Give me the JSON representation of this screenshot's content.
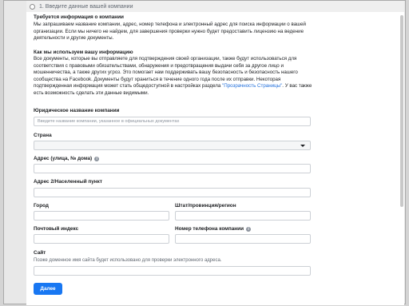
{
  "step": {
    "label": "1. Введите данные вашей компании"
  },
  "info_section": {
    "title": "Требуется информация о компании",
    "body": "Мы запрашиваем название компании, адрес, номер телефона и электронный адрес для поиска информации о вашей организации. Если мы ничего не найдем, для завершения проверки нужно будет предоставить лицензию на ведение деятельности и другие документы."
  },
  "usage_section": {
    "title": "Как мы используем вашу информацию",
    "body_start": "Все документы, которые вы отправляете для подтверждения своей организации, также будут использоваться для соответствия с правовыми обязательствами, обнаружения и предотвращения выдачи себя за другое лицо и мошенничества, а также других угроз. Это помогает нам поддерживать вашу безопасность и безопасность нашего сообщества на Facebook. Документы будут храниться в течение одного года после их отправки. Некоторая подтвержденная информация может стать общедоступной в настройках раздела ",
    "link": "\"Прозрачность Страницы\"",
    "body_end": ". У вас также есть возможность сделать эти данные видимыми."
  },
  "form": {
    "legal_name": {
      "label": "Юридическое название компании",
      "placeholder": "Введите название компании, указанное в официальных документах",
      "value": ""
    },
    "country": {
      "label": "Страна",
      "value": ""
    },
    "address1": {
      "label": "Адрес (улица, № дома)",
      "value": ""
    },
    "address2": {
      "label": "Адрес 2/Населенный пункт",
      "value": ""
    },
    "city": {
      "label": "Город",
      "value": ""
    },
    "state": {
      "label": "Штат/провинция/регион",
      "value": ""
    },
    "zip": {
      "label": "Почтовый индекс",
      "value": ""
    },
    "phone": {
      "label": "Номер телефона компании",
      "value": ""
    },
    "website": {
      "label": "Сайт",
      "hint": "Позже доменное имя сайта будет использовано для проверки электронного адреса.",
      "value": ""
    }
  },
  "next_button": {
    "label": "Далее"
  },
  "icons": {
    "info": "info-icon",
    "dropdown": "chevron-down-icon",
    "step": "radio-circle-icon"
  },
  "colors": {
    "primary": "#1877f2",
    "link": "#216fdb",
    "text": "#1c1e21",
    "muted": "#606770",
    "border": "#ccd0d5"
  }
}
